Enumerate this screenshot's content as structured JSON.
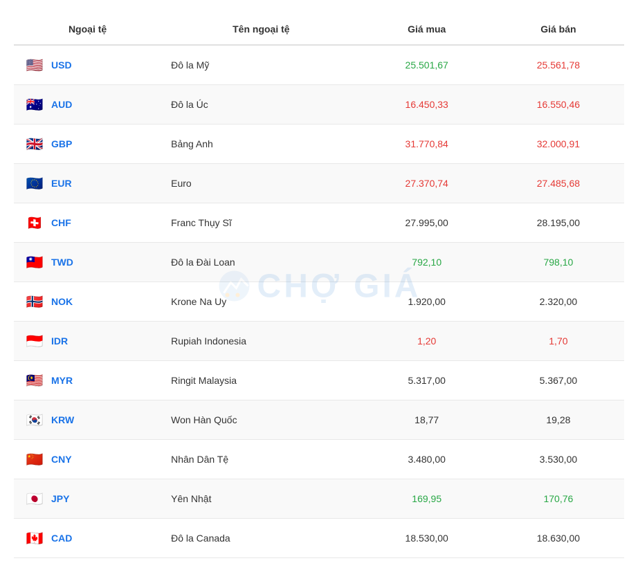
{
  "table": {
    "headers": [
      "Ngoại tệ",
      "Tên ngoại tệ",
      "Giá mua",
      "Giá bán"
    ],
    "rows": [
      {
        "code": "USD",
        "flag": "🇺🇸",
        "flagBg": "#fff",
        "name": "Đô la Mỹ",
        "buy": "25.501,67",
        "sell": "25.561,78",
        "buyColor": "green",
        "sellColor": "red"
      },
      {
        "code": "AUD",
        "flag": "🇦🇺",
        "flagBg": "#fff",
        "name": "Đô la Úc",
        "buy": "16.450,33",
        "sell": "16.550,46",
        "buyColor": "red",
        "sellColor": "red"
      },
      {
        "code": "GBP",
        "flag": "🇬🇧",
        "flagBg": "#fff",
        "name": "Bảng Anh",
        "buy": "31.770,84",
        "sell": "32.000,91",
        "buyColor": "red",
        "sellColor": "red"
      },
      {
        "code": "EUR",
        "flag": "🇪🇺",
        "flagBg": "#fff",
        "name": "Euro",
        "buy": "27.370,74",
        "sell": "27.485,68",
        "buyColor": "red",
        "sellColor": "red"
      },
      {
        "code": "CHF",
        "flag": "🇨🇭",
        "flagBg": "#fff",
        "name": "Franc Thụy Sĩ",
        "buy": "27.995,00",
        "sell": "28.195,00",
        "buyColor": "black",
        "sellColor": "black"
      },
      {
        "code": "TWD",
        "flag": "🇹🇼",
        "flagBg": "#fff",
        "name": "Đô la Đài Loan",
        "buy": "792,10",
        "sell": "798,10",
        "buyColor": "green",
        "sellColor": "green"
      },
      {
        "code": "NOK",
        "flag": "🇳🇴",
        "flagBg": "#fff",
        "name": "Krone Na Uy",
        "buy": "1.920,00",
        "sell": "2.320,00",
        "buyColor": "black",
        "sellColor": "black"
      },
      {
        "code": "IDR",
        "flag": "🇮🇩",
        "flagBg": "#fff",
        "name": "Rupiah Indonesia",
        "buy": "1,20",
        "sell": "1,70",
        "buyColor": "red",
        "sellColor": "red"
      },
      {
        "code": "MYR",
        "flag": "🇲🇾",
        "flagBg": "#fff",
        "name": "Ringit Malaysia",
        "buy": "5.317,00",
        "sell": "5.367,00",
        "buyColor": "black",
        "sellColor": "black"
      },
      {
        "code": "KRW",
        "flag": "🇰🇷",
        "flagBg": "#fff",
        "name": "Won Hàn Quốc",
        "buy": "18,77",
        "sell": "19,28",
        "buyColor": "black",
        "sellColor": "black"
      },
      {
        "code": "CNY",
        "flag": "🇨🇳",
        "flagBg": "#fff",
        "name": "Nhân Dân Tệ",
        "buy": "3.480,00",
        "sell": "3.530,00",
        "buyColor": "black",
        "sellColor": "black"
      },
      {
        "code": "JPY",
        "flag": "🇯🇵",
        "flagBg": "#fff",
        "name": "Yên Nhật",
        "buy": "169,95",
        "sell": "170,76",
        "buyColor": "green",
        "sellColor": "green"
      },
      {
        "code": "CAD",
        "flag": "🇨🇦",
        "flagBg": "#fff",
        "name": "Đô la Canada",
        "buy": "18.530,00",
        "sell": "18.630,00",
        "buyColor": "black",
        "sellColor": "black"
      }
    ]
  },
  "watermark": {
    "text": "CHỢ GIÁ"
  }
}
